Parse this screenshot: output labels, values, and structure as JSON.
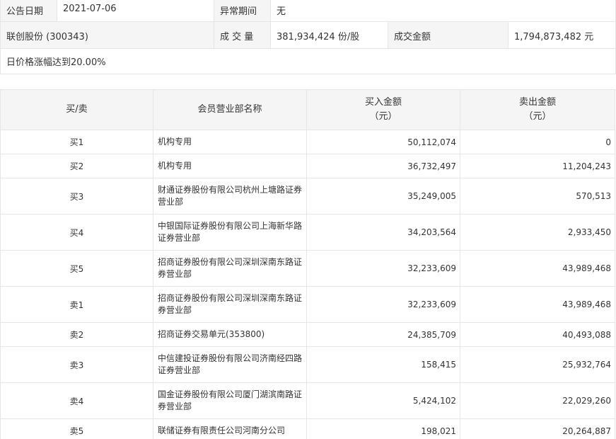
{
  "info": {
    "date_label": "公告日期",
    "date_value": "2021-07-06",
    "abnormal_label": "异常期间",
    "abnormal_value": "无",
    "stock_name": "联创股份 (300343)",
    "volume_label": "成 交 量",
    "volume_value": "381,934,424 份/股",
    "amount_label": "成交金额",
    "amount_value": "1,794,873,482 元",
    "reason": "日价格涨幅达到20.00%"
  },
  "table": {
    "headers": {
      "side": "买/卖",
      "branch": "会员营业部名称",
      "buy_line1": "买入金额",
      "buy_line2": "（元）",
      "sell_line1": "卖出金额",
      "sell_line2": "（元）"
    },
    "rows": [
      {
        "side": "买1",
        "branch_l1": "机构专用",
        "branch_l2": "",
        "buy": "50,112,074",
        "sell": "0"
      },
      {
        "side": "买2",
        "branch_l1": "机构专用",
        "branch_l2": "",
        "buy": "36,732,497",
        "sell": "11,204,243"
      },
      {
        "side": "买3",
        "branch_l1": "财通证券股份有限公司杭州上塘路证券",
        "branch_l2": "营业部",
        "buy": "35,249,005",
        "sell": "570,513"
      },
      {
        "side": "买4",
        "branch_l1": "中银国际证券股份有限公司上海新华路",
        "branch_l2": "证券营业部",
        "buy": "34,203,564",
        "sell": "2,933,450"
      },
      {
        "side": "买5",
        "branch_l1": "招商证券股份有限公司深圳深南东路证",
        "branch_l2": "券营业部",
        "buy": "32,233,609",
        "sell": "43,989,468"
      },
      {
        "side": "卖1",
        "branch_l1": "招商证券股份有限公司深圳深南东路证",
        "branch_l2": "券营业部",
        "buy": "32,233,609",
        "sell": "43,989,468"
      },
      {
        "side": "卖2",
        "branch_l1": "招商证券交易单元(353800)",
        "branch_l2": "",
        "buy": "24,385,709",
        "sell": "40,493,088"
      },
      {
        "side": "卖3",
        "branch_l1": "中信建投证券股份有限公司济南经四路",
        "branch_l2": "证券营业部",
        "buy": "158,415",
        "sell": "25,932,764"
      },
      {
        "side": "卖4",
        "branch_l1": "国金证券股份有限公司厦门湖滨南路证",
        "branch_l2": "券营业部",
        "buy": "5,424,102",
        "sell": "22,029,260"
      },
      {
        "side": "卖5",
        "branch_l1": "联储证券有限责任公司河南分公司",
        "branch_l2": "",
        "buy": "198,021",
        "sell": "20,264,887"
      }
    ]
  }
}
